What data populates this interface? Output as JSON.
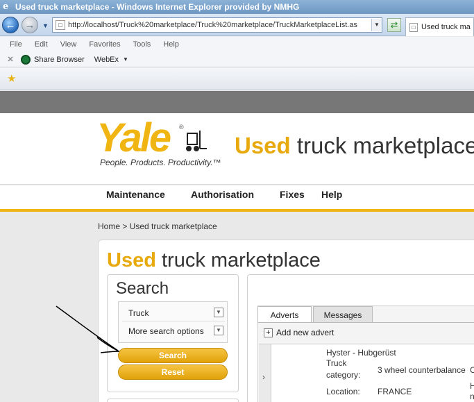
{
  "browser": {
    "title": "Used truck marketplace - Windows Internet Explorer provided by NMHG",
    "url": "http://localhost/Truck%20marketplace/Truck%20marketplace/TruckMarketplaceList.as",
    "tab_label": "Used truck ma",
    "menu": [
      "File",
      "Edit",
      "View",
      "Favorites",
      "Tools",
      "Help"
    ],
    "links": {
      "share": "Share Browser",
      "webex": "WebEx"
    }
  },
  "header": {
    "logo_word": "Yale",
    "logo_reg": "®",
    "tagline": "People. Products. Productivity.™",
    "title_highlight": "Used",
    "title_rest": " truck marketplace"
  },
  "nav": [
    "Maintenance",
    "Authorisation",
    "Fixes",
    "Help"
  ],
  "breadcrumb": "Home > Used truck marketplace",
  "page_title": {
    "highlight": "Used",
    "rest": " truck marketplace"
  },
  "search": {
    "title": "Search",
    "options": [
      "Truck",
      "More search options"
    ],
    "search_button": "Search",
    "reset_button": "Reset"
  },
  "results": {
    "tabs": [
      "Adverts",
      "Messages"
    ],
    "add_new": "Add new advert",
    "row": {
      "name": "Hyster - Hubgerüst",
      "category_label_1": "Truck",
      "category_label_2": "category:",
      "category_value": "3 wheel counterbalance",
      "category_extra": "C",
      "location_label": "Location:",
      "location_value": "FRANCE",
      "extra_1": "H",
      "extra_2": "n"
    }
  },
  "colors": {
    "accent": "#efb515",
    "brand_text": "#e8a90d"
  }
}
